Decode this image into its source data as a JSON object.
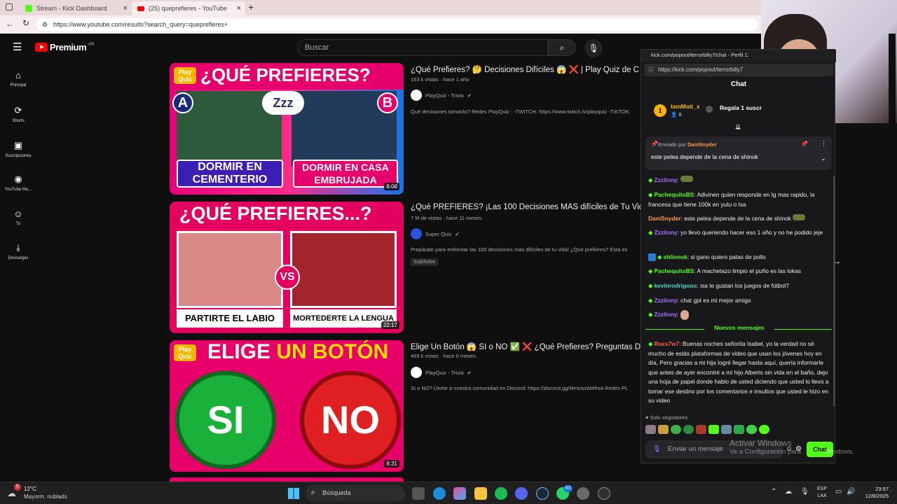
{
  "browser": {
    "tabs": [
      {
        "title": "Stream - Kick Dashboard"
      },
      {
        "title": "(25) queprefieres - YouTube"
      }
    ],
    "new_tab_symbol": "+",
    "url": "https://www.youtube.com/results?search_query=queprefieres+"
  },
  "youtube": {
    "logo": "Premium",
    "region": "AR",
    "search_placeholder": "Buscar",
    "sidebar": [
      {
        "label": "Principal",
        "icon": "home-icon"
      },
      {
        "label": "Shorts",
        "icon": "shorts-icon"
      },
      {
        "label": "Suscripciones",
        "icon": "subscriptions-icon"
      },
      {
        "label": "YouTube Mu...",
        "icon": "music-icon"
      },
      {
        "label": "Tú",
        "icon": "user-icon"
      },
      {
        "label": "Descargas",
        "icon": "download-icon"
      }
    ],
    "videos": [
      {
        "title": "¿Qué Prefieres? 🤔 Decisiones Difíciles 😱 ❌ | Play Quiz de C",
        "meta": "163 k vistas · hace 1 año",
        "channel": "PlayQuiz - Trivia",
        "description": "Qué decisiones tomarás? Redes PlayQuiz : -TWITCH: https://www.twitch.tv/playquiz -TIKTOK:",
        "duration": "8:06",
        "thumb_text_top": "¿QUÉ PREFIERES?",
        "thumb_a": "A",
        "thumb_b": "B",
        "thumb_zzz": "Zzz",
        "thumb_left": "DORMIR EN CEMENTERIO",
        "thumb_right": "DORMIR EN CASA EMBRUJADA",
        "thumb_logo": "Play Quiz",
        "badge": ""
      },
      {
        "title": "¿Qué PREFIERES? ¡Las 100 Decisiones MÁS difíciles de Tu Vid",
        "meta": "7 M de vistas · hace 11 meses",
        "channel": "Super Quiz",
        "description": "Prepárate para enfrentar las 100 decisiones más difíciles de tu vida! ¿Qué prefieres? Esta es",
        "duration": "22:17",
        "thumb_text_top": "¿QUÉ PREFIERES...?",
        "thumb_vs": "VS",
        "thumb_left": "PARTIRTE EL LABIO",
        "thumb_right": "MORTEDERTE LA LENGUA",
        "badge": "Subtítulos"
      },
      {
        "title": "Elige Un Botón 😱 SI o NO ✅ ❌ ¿Qué Prefieres? Preguntas D",
        "meta": "469 k vistas · hace 6 meses",
        "channel": "PlayQuiz - Trivia",
        "description": "SI o NO? Únete a nuestra comunidad en Discord: https://discord.gg/MmcwzM4fmA Redes PL",
        "duration": "8:31",
        "thumb_text_top_a": "ELIGE ",
        "thumb_text_top_b": "UN BOTÓN",
        "thumb_logo": "Play Quiz",
        "thumb_left": "SI",
        "thumb_right": "NO",
        "badge": ""
      }
    ]
  },
  "kick": {
    "window_title": "kick.com/popout/terrorbilly7/chat - Perfil 1:",
    "url": "https://kick.com/popout/terrorbilly7",
    "header": "Chat",
    "gift": {
      "rank": "1",
      "user": "IamMatt_x",
      "count": "8",
      "text": "Regala 1 suscr"
    },
    "pinned": {
      "prefix": "Enviado por",
      "user": "DaniSnyder",
      "text": "este pelea depende de la cena de shinok"
    },
    "messages": [
      {
        "user": "Zzzilony",
        "text": "",
        "color": "purple"
      },
      {
        "user": "PachequitoBS",
        "text": "Adivinen quien responde en Ig mas rapido, la francesa que tiene 100k en yutu o Isa",
        "color": "green"
      },
      {
        "user": "DaniSnyder",
        "text": "este pelea depende de la cena de shinok",
        "color": "orange"
      },
      {
        "user": "Zzzilony",
        "text": "yo llevo queriendo hacer eso 1 año y no he podido jeje",
        "color": "purple"
      },
      {
        "user": "shlinnok",
        "text": "si gano quiero patas de pollo",
        "color": "green"
      },
      {
        "user": "PachequitoBS",
        "text": "A machetazo limpio el puño es las lokas",
        "color": "green"
      },
      {
        "user": "kevinrodrigooo",
        "text": "isa te gustan los juegos de fútbol?",
        "color": "teal"
      },
      {
        "user": "Zzzilony",
        "text": "chat gpt es mi mejor amigo",
        "color": "purple"
      },
      {
        "user": "Zzzilony",
        "text": "",
        "color": "purple"
      }
    ],
    "new_messages_label": "Nuevos mensajes",
    "last_message": {
      "user": "Raxx7w7",
      "text": "Buenas noches señorita Isabel, yo la verdad no sé mucho de estás plataformas de video que usan los jóvenes hoy en día, Pero gracias a mi hija logré llegar hasta aquí, quería informarle que antes de ayer encontré a mi hijo Alberto sin vida en el baño, dejo una hoja de papel donde hablo de usted diciendo que usted lo llevo a tomar ese destino por los comentarios e insultos que usted le hizo en su video"
    },
    "followers_only": "Solo seguidores",
    "input_placeholder": "Enviar un mensaje",
    "send_label": "Chat"
  },
  "watermark": {
    "line1": "Activar Windows",
    "line2": "Ve a Configuración para",
    "line2b": "Windows."
  },
  "taskbar": {
    "weather_temp": "12°C",
    "weather_desc": "Mayorm. nublado",
    "weather_badge": "5",
    "search_label": "Búsqueda",
    "whatsapp_badge": "63",
    "lang_top": "ESP",
    "lang_bottom": "LAA",
    "time": "23:57",
    "date": "12/8/2025"
  },
  "colors": {
    "kick_green": "#53fc18",
    "yt_red": "#ff0000",
    "purple_user": "#a970ff"
  }
}
